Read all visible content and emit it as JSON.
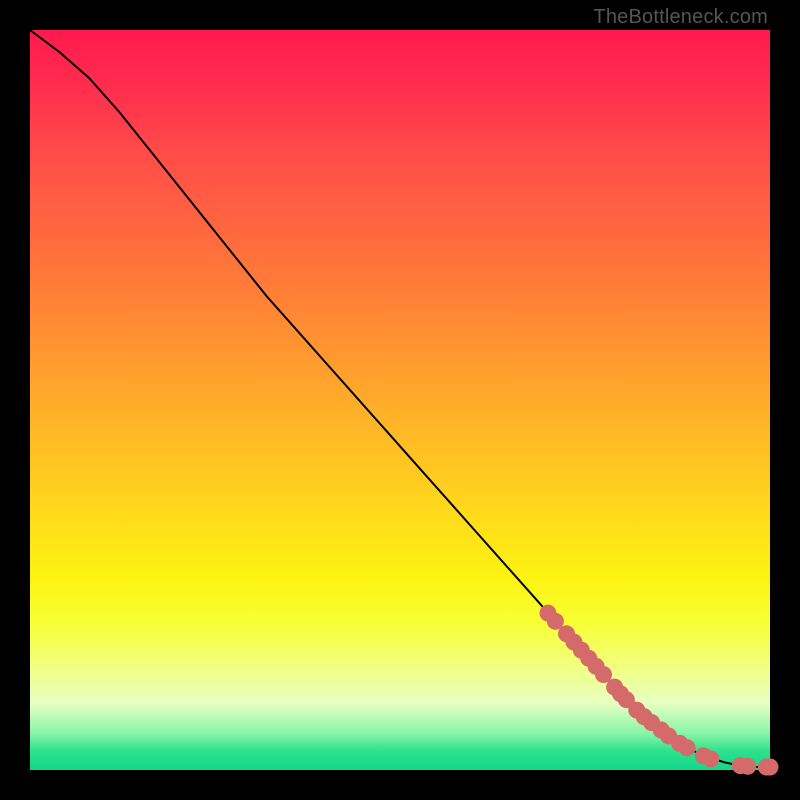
{
  "watermark": "TheBottleneck.com",
  "colors": {
    "bg": "#000000",
    "dot": "#D46A6A",
    "line": "#000000",
    "gradient_top": "#FF1A4D",
    "gradient_bottom": "#12D68A"
  },
  "chart_data": {
    "type": "line",
    "title": "",
    "xlabel": "",
    "ylabel": "",
    "xlim": [
      0,
      100
    ],
    "ylim": [
      0,
      100
    ],
    "grid": false,
    "x": [
      0,
      4,
      8,
      12,
      16,
      20,
      24,
      28,
      32,
      36,
      40,
      44,
      48,
      52,
      56,
      60,
      64,
      68,
      72,
      76,
      80,
      84,
      88,
      90,
      92,
      94,
      96,
      98,
      100
    ],
    "y": [
      100,
      97,
      93.5,
      89,
      84,
      79,
      74,
      69,
      64,
      59.5,
      55,
      50.5,
      46,
      41.5,
      37,
      32.5,
      28,
      23.5,
      19,
      14.5,
      10,
      6.5,
      3.5,
      2.4,
      1.6,
      1.0,
      0.6,
      0.4,
      0.4
    ],
    "markers": [
      {
        "x": 70,
        "y": 21.2
      },
      {
        "x": 71,
        "y": 20.1
      },
      {
        "x": 72.5,
        "y": 18.4
      },
      {
        "x": 73.5,
        "y": 17.3
      },
      {
        "x": 74.5,
        "y": 16.2
      },
      {
        "x": 75.5,
        "y": 15.1
      },
      {
        "x": 76.5,
        "y": 14.0
      },
      {
        "x": 77.5,
        "y": 12.9
      },
      {
        "x": 79,
        "y": 11.2
      },
      {
        "x": 79.8,
        "y": 10.3
      },
      {
        "x": 80.6,
        "y": 9.5
      },
      {
        "x": 82,
        "y": 8.1
      },
      {
        "x": 83,
        "y": 7.2
      },
      {
        "x": 84,
        "y": 6.4
      },
      {
        "x": 85.3,
        "y": 5.4
      },
      {
        "x": 86.3,
        "y": 4.6
      },
      {
        "x": 87.8,
        "y": 3.6
      },
      {
        "x": 88.8,
        "y": 3.0
      },
      {
        "x": 91,
        "y": 1.9
      },
      {
        "x": 92,
        "y": 1.5
      },
      {
        "x": 96,
        "y": 0.6
      },
      {
        "x": 97,
        "y": 0.5
      },
      {
        "x": 99.5,
        "y": 0.4
      },
      {
        "x": 100,
        "y": 0.4
      }
    ]
  }
}
